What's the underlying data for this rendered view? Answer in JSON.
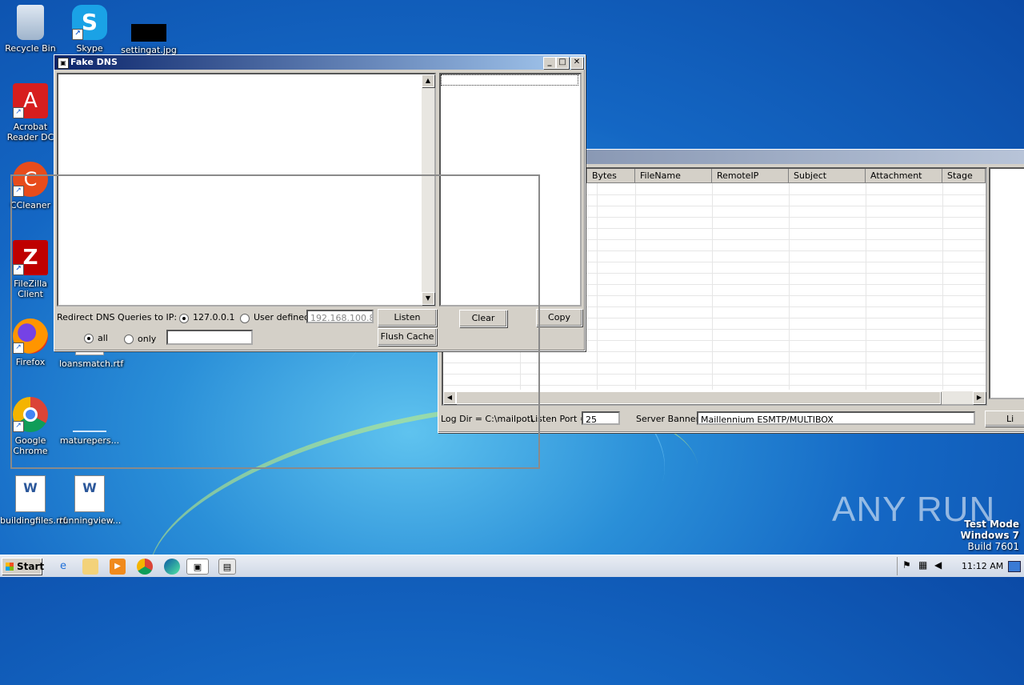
{
  "desktop": {
    "icons": [
      {
        "label": "Recycle Bin",
        "icon": "recycle-bin-icon",
        "glyph": "🗑"
      },
      {
        "label": "Skype",
        "icon": "skype-icon",
        "glyph": "S"
      },
      {
        "label": "settingat.jpg",
        "icon": "image-file-icon",
        "glyph": ""
      },
      {
        "label": "Acrobat Reader DC",
        "icon": "acrobat-icon",
        "glyph": "A"
      },
      {
        "label": "CCleaner",
        "icon": "ccleaner-icon",
        "glyph": "C"
      },
      {
        "label": "FileZilla Client",
        "icon": "filezilla-icon",
        "glyph": "Z"
      },
      {
        "label": "Firefox",
        "icon": "firefox-icon",
        "glyph": ""
      },
      {
        "label": "loansmatch.rtf",
        "icon": "rtf-file-icon",
        "glyph": ""
      },
      {
        "label": "Google Chrome",
        "icon": "chrome-icon",
        "glyph": ""
      },
      {
        "label": "maturepers...",
        "icon": "file-icon",
        "glyph": ""
      },
      {
        "label": "buildingfiles.rtf",
        "icon": "word-doc-icon",
        "glyph": "W"
      },
      {
        "label": "runningview...",
        "icon": "word-doc-icon",
        "glyph": "W"
      }
    ]
  },
  "fake_dns": {
    "title": "Fake DNS",
    "redirect_label": "Redirect DNS Queries to IP:",
    "radio_localhost": "127.0.0.1",
    "radio_user_defined": "User defined",
    "ip_placeholder": "192.168.100.8",
    "listen_button": "Listen",
    "clear_button": "Clear",
    "copy_button": "Copy",
    "flush_cache_button": "Flush Cache",
    "radio_all": "all",
    "radio_only": "only",
    "only_value": ""
  },
  "mailpot": {
    "columns": [
      "Bytes",
      "FileName",
      "RemoteIP",
      "Subject",
      "Attachment",
      "Stage"
    ],
    "log_dir": "Log Dir = C:\\mailpot\\",
    "listen_port_label": "Listen Port =",
    "listen_port_value": "25",
    "server_banner_label": "Server Banner",
    "server_banner_value": "Maillennium ESMTP/MULTIBOX",
    "right_button_partial": "Li"
  },
  "watermark": {
    "brand": "ANY RUN",
    "test_mode": "Test Mode",
    "os": "Windows 7",
    "build": "Build 7601"
  },
  "taskbar": {
    "start_label": "Start",
    "clock": "11:12 AM"
  }
}
